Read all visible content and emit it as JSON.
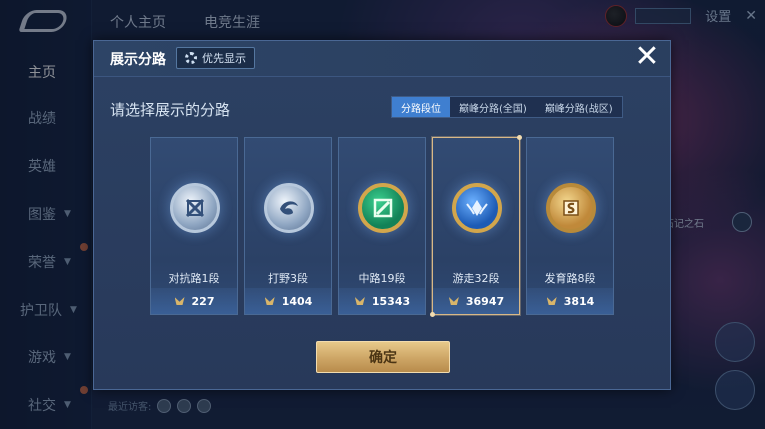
{
  "colors": {
    "accent_blue": "#3f7fd0",
    "gold": "#d2a64c",
    "modal_bg": "#2c4163"
  },
  "top_tabs": [
    "个人主页",
    "电竞生涯"
  ],
  "top_right": {
    "settings_label": "设置"
  },
  "sidebar": {
    "items": [
      {
        "label": "主页",
        "active": true,
        "chevron": false
      },
      {
        "label": "战绩",
        "active": false,
        "chevron": false
      },
      {
        "label": "英雄",
        "active": false,
        "chevron": false
      },
      {
        "label": "图鉴",
        "active": false,
        "chevron": true
      },
      {
        "label": "荣誉",
        "active": false,
        "chevron": true
      },
      {
        "label": "护卫队",
        "active": false,
        "chevron": true
      },
      {
        "label": "游戏",
        "active": false,
        "chevron": true
      },
      {
        "label": "社交",
        "active": false,
        "chevron": true
      }
    ]
  },
  "background": {
    "visitors_label": "最近访客:",
    "side_label": "石记之石"
  },
  "modal": {
    "title": "展示分路",
    "priority_label": "优先显示",
    "subtitle": "请选择展示的分路",
    "close_icon": "close-icon",
    "seg_tabs": [
      {
        "label": "分路段位",
        "active": true
      },
      {
        "label": "巅峰分路(全国)",
        "active": false
      },
      {
        "label": "巅峰分路(战区)",
        "active": false
      }
    ],
    "cards": [
      {
        "name": "对抗路1段",
        "score": "227",
        "emblem": "sword-emblem-silver",
        "selected": false
      },
      {
        "name": "打野3段",
        "score": "1404",
        "emblem": "wind-emblem-silver",
        "selected": false
      },
      {
        "name": "中路19段",
        "score": "15343",
        "emblem": "mage-emblem-gold-green",
        "selected": false
      },
      {
        "name": "游走32段",
        "score": "36947",
        "emblem": "support-emblem-gold-blue",
        "selected": true
      },
      {
        "name": "发育路8段",
        "score": "3814",
        "emblem": "marksman-emblem-gold",
        "selected": false
      }
    ],
    "confirm_label": "确定"
  }
}
